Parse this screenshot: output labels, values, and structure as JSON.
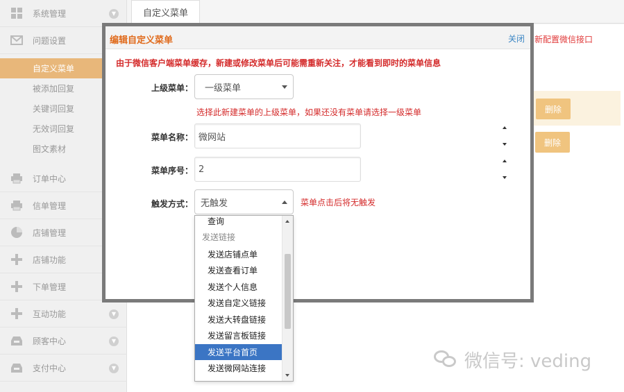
{
  "sidebar": {
    "items": [
      {
        "label": "系统管理",
        "icon": "grid-icon",
        "expand": true
      },
      {
        "label": "问题设置",
        "icon": "mail-icon",
        "expand": false
      },
      {
        "label": "订单中心",
        "icon": "printer-icon",
        "expand": false
      },
      {
        "label": "信单管理",
        "icon": "printer-icon",
        "expand": false
      },
      {
        "label": "店铺管理",
        "icon": "pie-icon",
        "expand": false
      },
      {
        "label": "店铺功能",
        "icon": "plus-icon",
        "expand": false
      },
      {
        "label": "下单管理",
        "icon": "plus-icon",
        "expand": false
      },
      {
        "label": "互动功能",
        "icon": "plus-icon",
        "expand": true
      },
      {
        "label": "顾客中心",
        "icon": "inbox-icon",
        "expand": true
      },
      {
        "label": "支付中心",
        "icon": "inbox-icon",
        "expand": true
      }
    ],
    "sub_items": [
      {
        "label": "自定义菜单",
        "active": true
      },
      {
        "label": "被添加回复",
        "active": false
      },
      {
        "label": "关键词回复",
        "active": false
      },
      {
        "label": "无效词回复",
        "active": false
      },
      {
        "label": "图文素材",
        "active": false
      }
    ]
  },
  "tabs": {
    "active": "自定义菜单"
  },
  "background": {
    "link": "新配置微信接口",
    "delete1": "删除",
    "delete2": "删除"
  },
  "modal": {
    "title": "编辑自定义菜单",
    "close": "关闭",
    "notice": "由于微信客户端菜单缓存，新建或修改菜单后可能需重新关注，才能看到即时的菜单信息",
    "parent_label": "上级菜单：",
    "parent_value": "一级菜单",
    "parent_hint": "选择此新建菜单的上级菜单，如果还没有菜单请选择一级菜单",
    "name_label": "菜单名称：",
    "name_value": "微网站",
    "order_label": "菜单序号：",
    "order_value": "2",
    "trigger_label": "触发方式：",
    "trigger_value": "无触发",
    "trigger_hint": "菜单点击后将无触发"
  },
  "dropdown": {
    "items": [
      {
        "label": "查询",
        "type": "option"
      },
      {
        "label": "发送链接",
        "type": "group"
      },
      {
        "label": "发送店铺点单",
        "type": "option"
      },
      {
        "label": "发送查看订单",
        "type": "option"
      },
      {
        "label": "发送个人信息",
        "type": "option"
      },
      {
        "label": "发送自定义链接",
        "type": "option"
      },
      {
        "label": "发送大转盘链接",
        "type": "option"
      },
      {
        "label": "发送留言板链接",
        "type": "option"
      },
      {
        "label": "发送平台首页",
        "type": "selected"
      },
      {
        "label": "发送微网站连接",
        "type": "option"
      }
    ]
  },
  "watermark": {
    "text": "微信号: veding"
  },
  "colors": {
    "accent": "#e8b77a",
    "warning": "#d42b2b",
    "title": "#e06a1b",
    "link": "#3b86c4",
    "selection": "#3b75c4"
  }
}
